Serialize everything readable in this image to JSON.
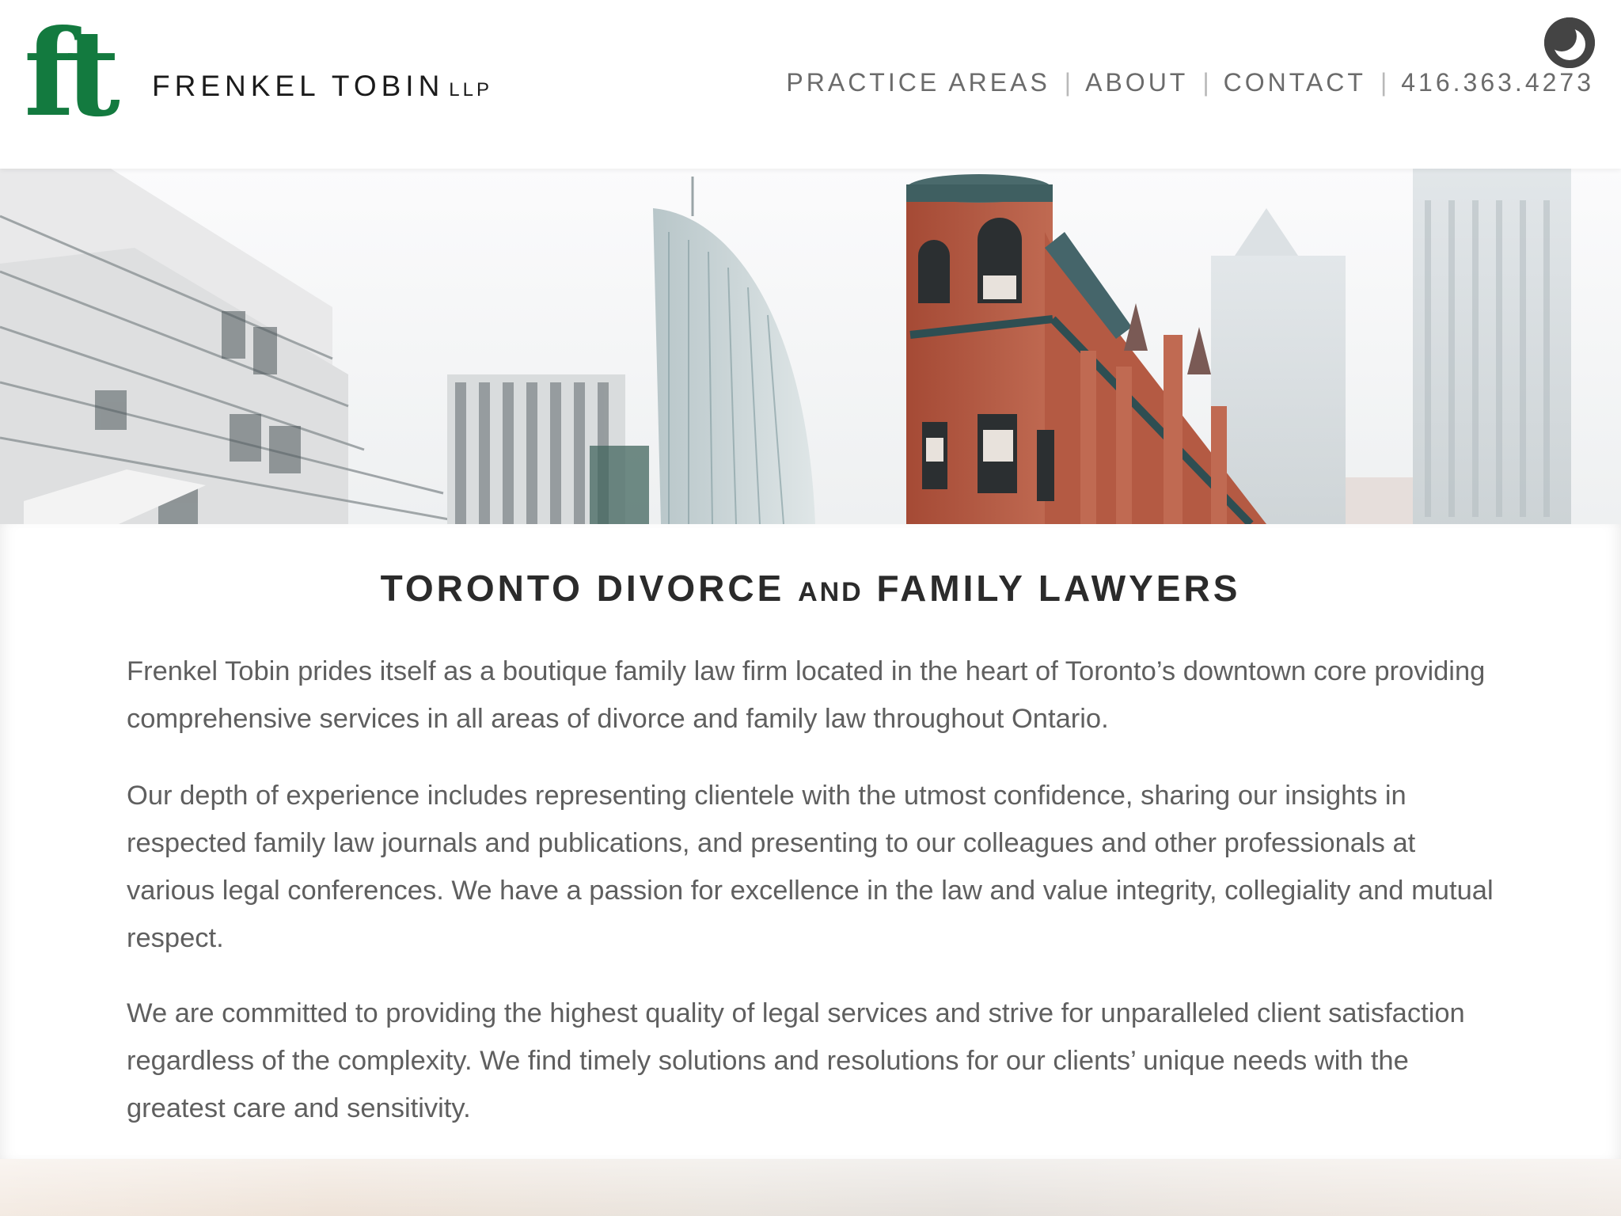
{
  "brand": {
    "logo_mark": "ft",
    "name": "FRENKEL TOBIN",
    "suffix": "LLP",
    "logo_color": "#137a3f"
  },
  "theme_toggle": {
    "icon": "moon-icon"
  },
  "nav": {
    "items": [
      {
        "label": "PRACTICE AREAS"
      },
      {
        "label": "ABOUT"
      },
      {
        "label": "CONTACT"
      },
      {
        "label": "416.363.4273"
      }
    ],
    "separator": "|"
  },
  "hero": {
    "image": "toronto-skyline-photo"
  },
  "main": {
    "title_part1": "TORONTO DIVORCE",
    "title_part2": "AND",
    "title_part3": "FAMILY LAWYERS",
    "paragraphs": [
      "Frenkel Tobin prides itself as a boutique family law firm located in the heart of Toronto’s downtown core providing comprehensive services in all areas of divorce and family law throughout Ontario.",
      "Our depth of experience includes representing clientele with the utmost confidence, sharing our insights in respected family law journals and publications, and presenting to our colleagues and other professionals at various legal conferences. We have a passion for excellence in the law and value integrity, collegiality and mutual respect.",
      "We are committed to providing the highest quality of legal services and strive for unparalleled client satisfaction regardless of the complexity. We find timely solutions and resolutions for our clients’ unique needs with the greatest care and sensitivity."
    ]
  },
  "colors": {
    "accent_green": "#137a3f",
    "nav_text": "#6b6b6b",
    "body_text": "#5f5f5f",
    "heading_text": "#2b2b2b"
  }
}
